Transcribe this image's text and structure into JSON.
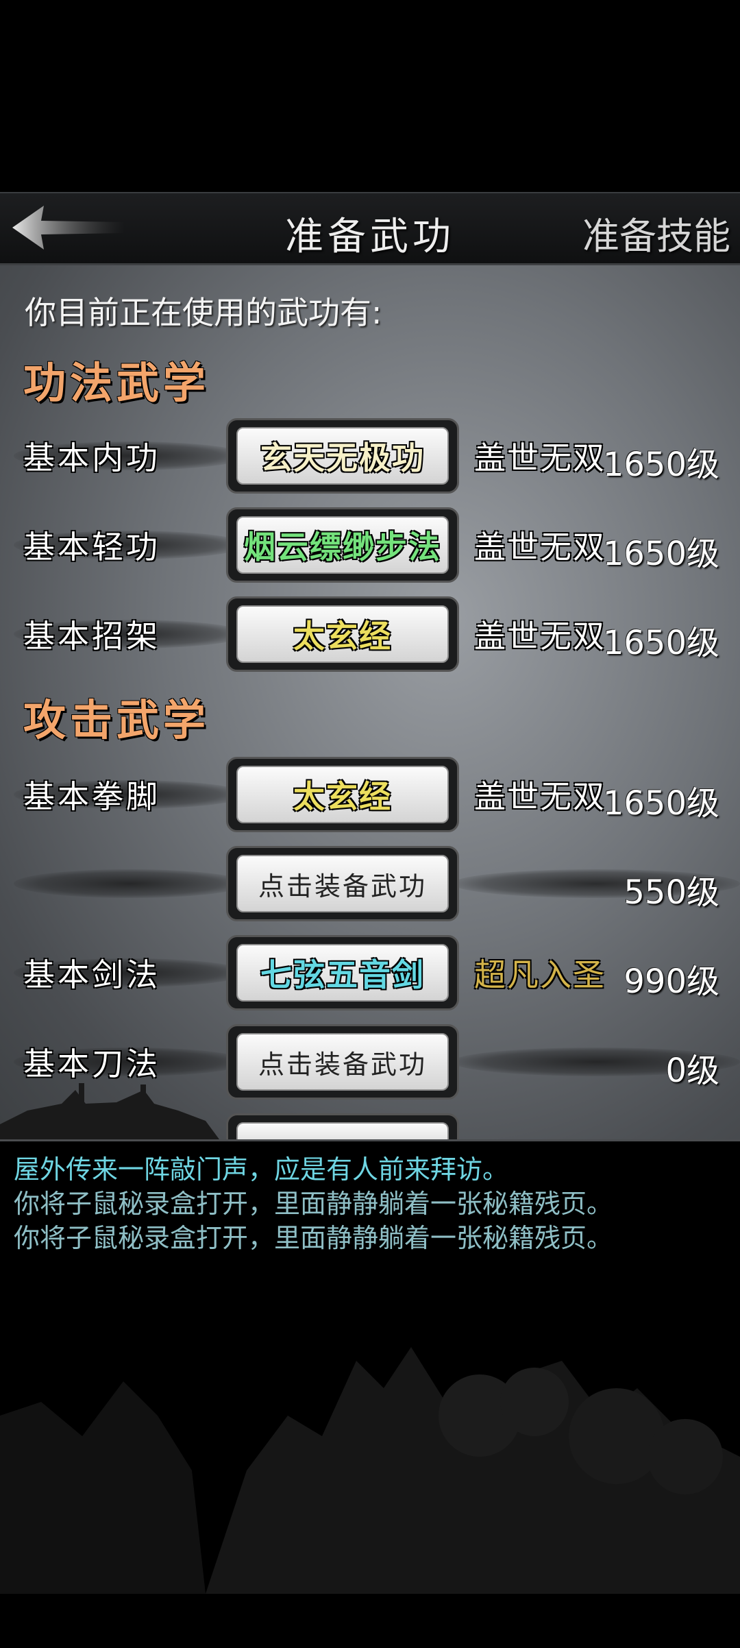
{
  "header": {
    "title": "准备武功",
    "right_tab": "准备技能"
  },
  "intro_text": "你目前正在使用的武功有:",
  "sections": [
    {
      "title": "功法武学",
      "rows": [
        {
          "label": "基本内功",
          "skill": "玄天无极功",
          "skill_color": "#f6f0c8",
          "rank": "盖世无双",
          "level": "1650级"
        },
        {
          "label": "基本轻功",
          "skill": "烟云缥缈步法",
          "skill_color": "#74e27c",
          "rank": "盖世无双",
          "level": "1650级"
        },
        {
          "label": "基本招架",
          "skill": "太玄经",
          "skill_color": "#ecde5e",
          "rank": "盖世无双",
          "level": "1650级"
        }
      ]
    },
    {
      "title": "攻击武学",
      "rows": [
        {
          "label": "基本拳脚",
          "skill": "太玄经",
          "skill_color": "#ecde5e",
          "rank": "盖世无双",
          "level": "1650级"
        },
        {
          "label": "",
          "skill": "点击装备武功",
          "skill_color": "#222222",
          "rank": "",
          "level": "550级"
        },
        {
          "label": "基本剑法",
          "skill": "七弦五音剑",
          "skill_color": "#63d8e3",
          "rank": "超凡入圣",
          "level": "990级"
        },
        {
          "label": "基本刀法",
          "skill": "点击装备武功",
          "skill_color": "#222222",
          "rank": "",
          "level": "0级"
        }
      ]
    }
  ],
  "log": [
    {
      "text": "屋外传来一阵敲门声，应是有人前来拜访。",
      "color": "#6fd6e3"
    },
    {
      "text": "你将子鼠秘录盒打开，里面静静躺着一张秘籍残页。",
      "color": "#8fbfc6"
    },
    {
      "text": "你将子鼠秘录盒打开，里面静静躺着一张秘籍残页。",
      "color": "#8fbfc6"
    }
  ],
  "colors": {
    "section_title": "#f3a56b",
    "rank_gold": "#d3b34a",
    "log_highlight": "#6fd6e3"
  }
}
